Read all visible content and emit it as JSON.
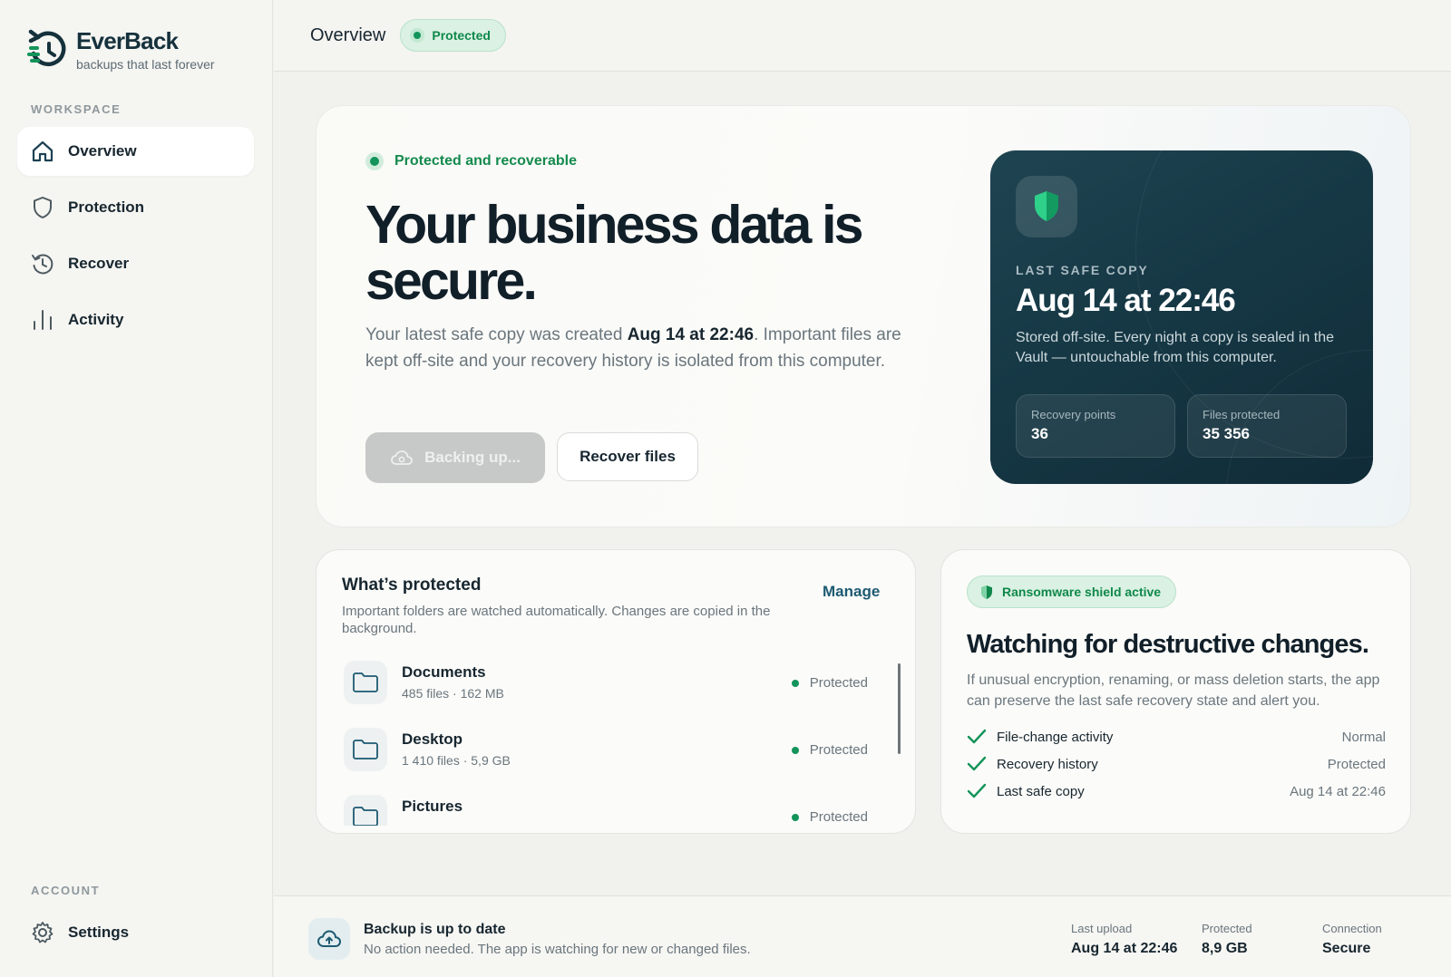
{
  "brand": {
    "name": "EverBack",
    "tagline": "backups that last forever",
    "accent": "#13945a",
    "dark": "#15313c"
  },
  "sidebar": {
    "workspace_label": "WORKSPACE",
    "account_label": "ACCOUNT",
    "items": [
      {
        "label": "Overview",
        "icon": "home-icon",
        "active": true
      },
      {
        "label": "Protection",
        "icon": "shield-icon",
        "active": false
      },
      {
        "label": "Recover",
        "icon": "history-icon",
        "active": false
      },
      {
        "label": "Activity",
        "icon": "bar-chart-icon",
        "active": false
      }
    ],
    "settings": {
      "label": "Settings",
      "icon": "gear-icon"
    }
  },
  "topbar": {
    "title": "Overview",
    "status": "Protected"
  },
  "hero": {
    "status": "Protected and recoverable",
    "heading": "Your business data is secure.",
    "body_prefix": "Your latest safe copy was created ",
    "body_time": "Aug 14 at 22:46",
    "body_suffix": ". Important files are kept off-site and your recovery history is isolated from this computer.",
    "backup_button": "Backing up...",
    "recover_button": "Recover files"
  },
  "safe_copy": {
    "label": "LAST SAFE COPY",
    "time": "Aug 14 at 22:46",
    "description": "Stored off-site. Every night a copy is sealed in the Vault — untouchable from this computer.",
    "stats": [
      {
        "label": "Recovery points",
        "value": "36"
      },
      {
        "label": "Files protected",
        "value": "35 356"
      }
    ]
  },
  "protected": {
    "title": "What’s protected",
    "description": "Important folders are watched automatically. Changes are copied in the background.",
    "manage": "Manage",
    "folders": [
      {
        "name": "Documents",
        "meta": "485 files · 162 MB",
        "status": "Protected"
      },
      {
        "name": "Desktop",
        "meta": "1 410 files · 5,9 GB",
        "status": "Protected"
      },
      {
        "name": "Pictures",
        "meta": "",
        "status": "Protected"
      }
    ]
  },
  "shield": {
    "badge": "Ransomware shield active",
    "heading": "Watching for destructive changes.",
    "description": "If unusual encryption, renaming, or mass deletion starts, the app can preserve the last safe recovery state and alert you.",
    "checks": [
      {
        "label": "File-change activity",
        "value": "Normal"
      },
      {
        "label": "Recovery history",
        "value": "Protected"
      },
      {
        "label": "Last safe copy",
        "value": "Aug 14 at 22:46"
      }
    ]
  },
  "bottombar": {
    "title": "Backup is up to date",
    "subtitle": "No action needed. The app is watching for new or changed files.",
    "stats": [
      {
        "label": "Last upload",
        "value": "Aug 14 at 22:46"
      },
      {
        "label": "Protected",
        "value": "8,9 GB"
      },
      {
        "label": "Connection",
        "value": "Secure"
      }
    ]
  }
}
